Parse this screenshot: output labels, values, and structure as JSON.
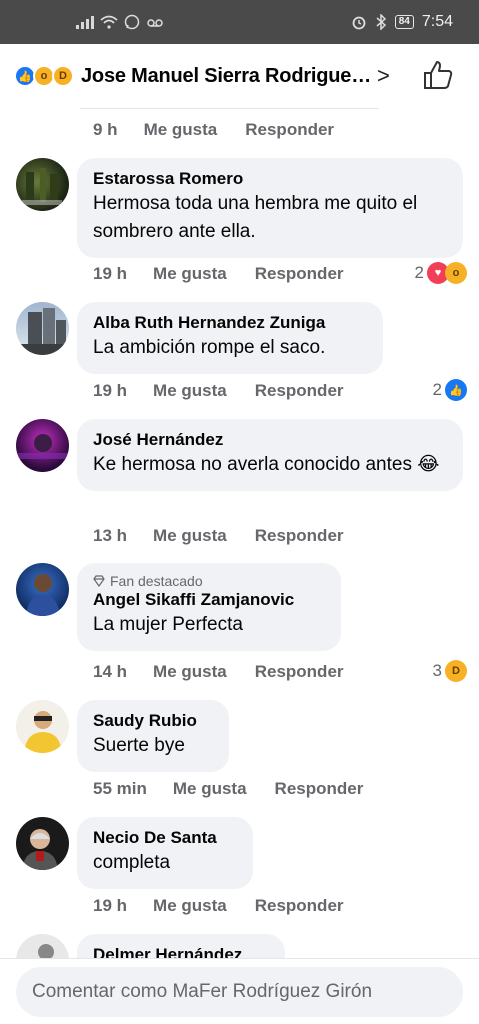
{
  "status_bar": {
    "left_icons": [
      "signal-icon",
      "wifi-icon",
      "whatsapp-icon",
      "voicemail-icon"
    ],
    "right_icons": [
      "alarm-icon",
      "bluetooth-icon"
    ],
    "battery": "84",
    "time": "7:54"
  },
  "header": {
    "title": "Jose Manuel Sierra Rodrigue…",
    "reactions": [
      "like",
      "wow",
      "haha"
    ],
    "chevron": ">",
    "like_icon": "thumbs-up-icon"
  },
  "actions": {
    "like": "Me gusta",
    "reply": "Responder"
  },
  "comments": [
    {
      "author": "",
      "text": "",
      "age": "9 h"
    },
    {
      "author": "Estarossa Romero",
      "text": "Hermosa toda una hembra me quito el sombrero ante ella.",
      "age": "19 h",
      "reaction_count": "2",
      "reactions": [
        "love",
        "wow"
      ]
    },
    {
      "author": "Alba Ruth Hernandez Zuniga",
      "text": "La ambición rompe el saco.",
      "age": "19 h",
      "reaction_count": "2",
      "reactions": [
        "like"
      ]
    },
    {
      "author": "José Hernández",
      "text": "Ke hermosa no averla conocido antes 😂",
      "age": "13 h"
    },
    {
      "author": "Angel Sikaffi Zamjanovic",
      "badge": "Fan destacado",
      "text": "La mujer Perfecta",
      "age": "14 h",
      "reaction_count": "3",
      "reactions": [
        "haha"
      ]
    },
    {
      "author": "Saudy Rubio",
      "text": "Suerte bye",
      "age": "55 min"
    },
    {
      "author": "Necio De Santa",
      "text": "completa",
      "age": "19 h"
    },
    {
      "author": "Delmer Hernández",
      "text": "",
      "age": ""
    }
  ],
  "composer": {
    "placeholder": "Comentar como MaFer Rodríguez Girón"
  },
  "colors": {
    "accent": "#1877f2",
    "bubble": "#f0f2f5",
    "muted": "#65676b",
    "status_bar": "#4a4a4a"
  }
}
